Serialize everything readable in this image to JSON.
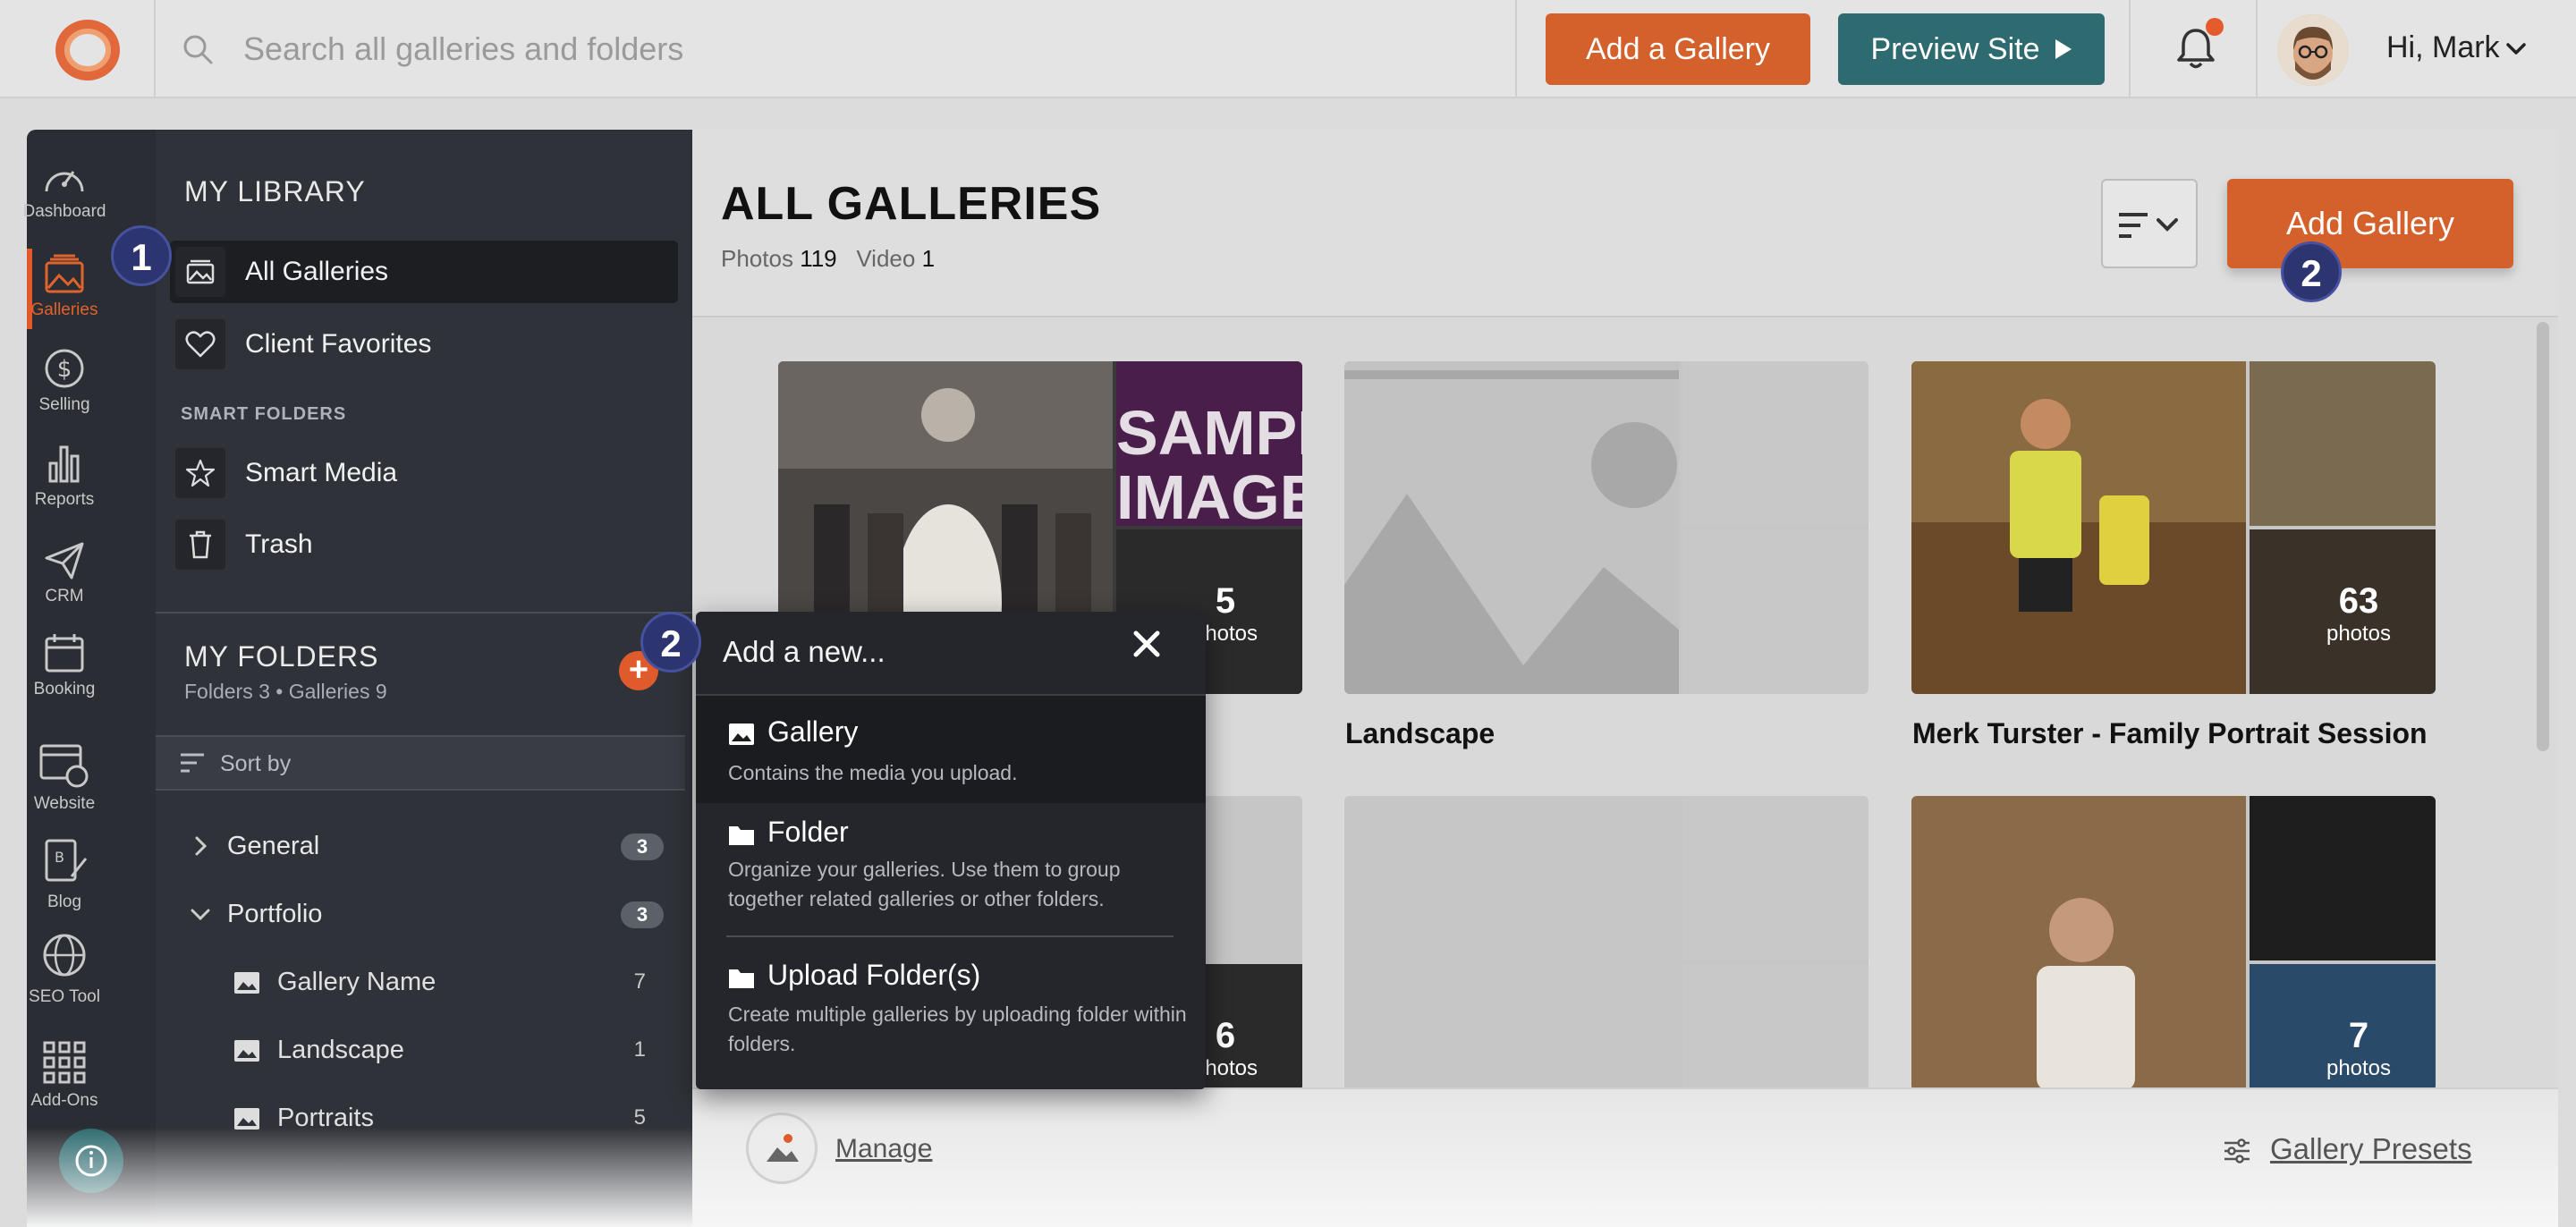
{
  "topbar": {
    "search_placeholder": "Search all galleries and folders",
    "add_gallery_label": "Add a Gallery",
    "preview_site_label": "Preview Site",
    "greeting": "Hi, Mark"
  },
  "rail": {
    "items": [
      {
        "label": "Dashboard",
        "icon": "dashboard-gauge-icon"
      },
      {
        "label": "Galleries",
        "icon": "galleries-icon",
        "active": true
      },
      {
        "label": "Selling",
        "icon": "dollar-circle-icon"
      },
      {
        "label": "Reports",
        "icon": "bar-chart-icon"
      },
      {
        "label": "CRM",
        "icon": "paper-plane-icon"
      },
      {
        "label": "Booking",
        "icon": "calendar-icon"
      },
      {
        "label": "Website",
        "icon": "website-icon"
      },
      {
        "label": "Blog",
        "icon": "blog-icon"
      },
      {
        "label": "SEO Tool",
        "icon": "seo-globe-icon"
      },
      {
        "label": "Add-Ons",
        "icon": "grid-icon"
      }
    ]
  },
  "library": {
    "title": "MY LIBRARY",
    "all_galleries": "All Galleries",
    "client_favorites": "Client Favorites",
    "smart_folders_label": "SMART FOLDERS",
    "smart_media": "Smart Media",
    "trash": "Trash"
  },
  "folders": {
    "title": "MY FOLDERS",
    "subtitle": "Folders 3 • Galleries 9",
    "sort_by": "Sort by",
    "items": [
      {
        "label": "General",
        "count": "3",
        "expanded": false
      },
      {
        "label": "Portfolio",
        "count": "3",
        "expanded": true
      }
    ],
    "children": [
      {
        "label": "Gallery Name",
        "count": "7"
      },
      {
        "label": "Landscape",
        "count": "1"
      },
      {
        "label": "Portraits",
        "count": "5"
      }
    ]
  },
  "main": {
    "title": "ALL GALLERIES",
    "photos_label": "Photos",
    "photos_count": "119",
    "video_label": "Video",
    "video_count": "1",
    "add_gallery_label": "Add Gallery",
    "cards": [
      {
        "title": "",
        "overlay_number": "5",
        "overlay_label": "photos"
      },
      {
        "title": "Landscape"
      },
      {
        "title": "Merk Turster - Family Portrait Session",
        "overlay_number": "63",
        "overlay_label": "photos"
      },
      {
        "title": "",
        "overlay_number": "6",
        "overlay_label": "photos"
      },
      {
        "title": ""
      },
      {
        "title": "",
        "overlay_number": "7",
        "overlay_label": "photos"
      }
    ],
    "sample_text_1": "SAMPL",
    "sample_text_2": "IMAGE"
  },
  "popup": {
    "title": "Add a new...",
    "items": [
      {
        "heading": "Gallery",
        "desc": "Contains the media you upload."
      },
      {
        "heading": "Folder",
        "desc": "Organize your galleries. Use them to group together related galleries or other folders."
      },
      {
        "heading": "Upload Folder(s)",
        "desc": "Create multiple galleries by uploading folder within folders."
      }
    ]
  },
  "footer": {
    "manage_label": "Manage",
    "presets_label": "Gallery Presets"
  },
  "badges": [
    "1",
    "2",
    "2"
  ],
  "colors": {
    "accent_orange": "#d4612c",
    "teal": "#2e6b70",
    "sidebar_dark": "#2f3238",
    "badge_blue": "#2d3570"
  }
}
